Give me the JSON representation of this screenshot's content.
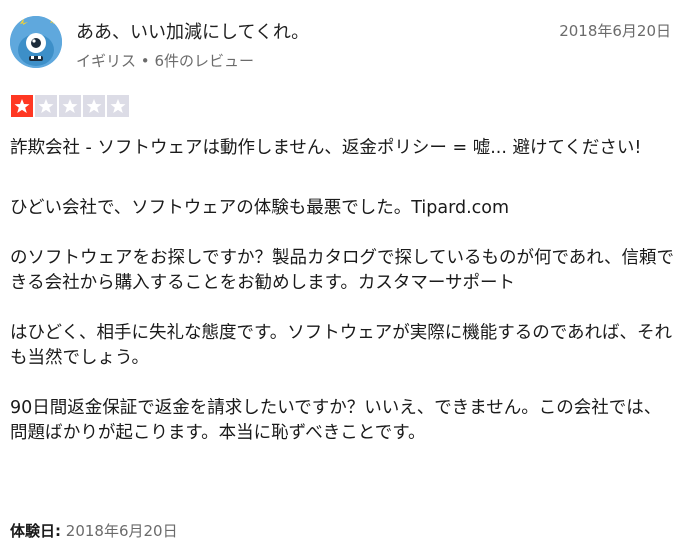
{
  "reviewer": {
    "name": "ああ、いい加減にしてくれ。",
    "country": "イギリス",
    "separator": "•",
    "review_count": "6件のレビュー",
    "avatar_icon": "monster-avatar-icon"
  },
  "review": {
    "date": "2018年6月20日",
    "rating": 1,
    "rating_max": 5,
    "star_on_color": "#ff3722",
    "star_off_color": "#dcdce6",
    "title": "詐欺会社 - ソフトウェアは動作しません、返金ポリシー = 嘘... 避けてください!",
    "paragraphs": [
      "ひどい会社で、ソフトウェアの体験も最悪でした。Tipard.com",
      "のソフトウェアをお探しですか？製品カタログで探しているものが何であれ、信頼できる会社から購入することをお勧めします。カスタマーサポート",
      "はひどく、相手に失礼な態度です。ソフトウェアが実際に機能するのであれば、それも当然でしょう。",
      "90日間返金保証で返金を請求したいですか？いいえ、できません。この会社では、問題ばかりが起こります。本当に恥ずべきことです。"
    ],
    "experience_label": "体験日:",
    "experience_date": "2018年6月20日"
  }
}
